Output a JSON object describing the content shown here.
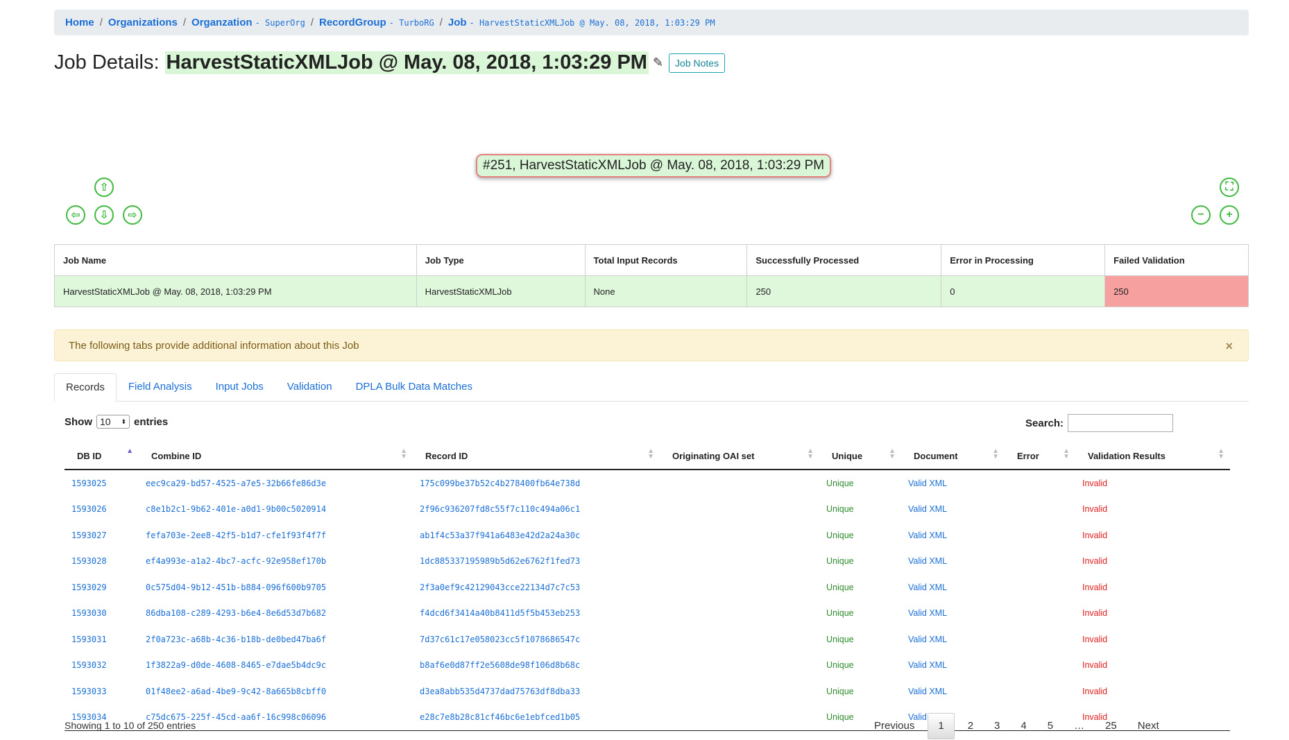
{
  "breadcrumb": {
    "home": "Home",
    "organizations": "Organizations",
    "organization": {
      "label": "Organzation",
      "sub": "- SuperOrg"
    },
    "record_group": {
      "label": "RecordGroup",
      "sub": "- TurboRG"
    },
    "job": {
      "label": "Job",
      "sub": "- HarvestStaticXMLJob @ May. 08, 2018, 1:03:29 PM"
    },
    "separator": "/"
  },
  "title": {
    "prefix": "Job Details:",
    "name": "HarvestStaticXMLJob @ May. 08, 2018, 1:03:29 PM",
    "edit_icon": "pencil-icon",
    "notes_button": "Job Notes"
  },
  "graph": {
    "node_label": "#251, HarvestStaticXMLJob @ May. 08, 2018, 1:03:29 PM",
    "controls": [
      "arrow-up-icon",
      "arrow-left-icon",
      "arrow-down-icon",
      "arrow-right-icon",
      "fit-icon",
      "zoom-out-icon",
      "zoom-in-icon"
    ],
    "accent": "#3fb93f"
  },
  "summary": {
    "headers": [
      "Job Name",
      "Job Type",
      "Total Input Records",
      "Successfully Processed",
      "Error in Processing",
      "Failed Validation"
    ],
    "values": [
      "HarvestStaticXMLJob @ May. 08, 2018, 1:03:29 PM",
      "HarvestStaticXMLJob",
      "None",
      "250",
      "0",
      "250"
    ]
  },
  "alert": {
    "text": "The following tabs provide additional information about this Job",
    "close": "×"
  },
  "tabs": [
    "Records",
    "Field Analysis",
    "Input Jobs",
    "Validation",
    "DPLA Bulk Data Matches"
  ],
  "table_controls": {
    "show": "Show",
    "length": "10",
    "entries": "entries",
    "search_label": "Search:",
    "search_value": ""
  },
  "records": {
    "columns": [
      "DB ID",
      "Combine ID",
      "Record ID",
      "Originating OAI set",
      "Unique",
      "Document",
      "Error",
      "Validation Results"
    ],
    "rows": [
      {
        "db_id": "1593025",
        "combine_id": "eec9ca29-bd57-4525-a7e5-32b66fe86d3e",
        "record_id": "175c099be37b52c4b278400fb64e738d",
        "oai_set": "",
        "unique": "Unique",
        "document": "Valid XML",
        "error": "",
        "validation": "Invalid"
      },
      {
        "db_id": "1593026",
        "combine_id": "c8e1b2c1-9b62-401e-a0d1-9b00c5020914",
        "record_id": "2f96c936207fd8c55f7c110c494a06c1",
        "oai_set": "",
        "unique": "Unique",
        "document": "Valid XML",
        "error": "",
        "validation": "Invalid"
      },
      {
        "db_id": "1593027",
        "combine_id": "fefa703e-2ee8-42f5-b1d7-cfe1f93f4f7f",
        "record_id": "ab1f4c53a37f941a6483e42d2a24a30c",
        "oai_set": "",
        "unique": "Unique",
        "document": "Valid XML",
        "error": "",
        "validation": "Invalid"
      },
      {
        "db_id": "1593028",
        "combine_id": "ef4a993e-a1a2-4bc7-acfc-92e958ef170b",
        "record_id": "1dc885337195989b5d62e6762f1fed73",
        "oai_set": "",
        "unique": "Unique",
        "document": "Valid XML",
        "error": "",
        "validation": "Invalid"
      },
      {
        "db_id": "1593029",
        "combine_id": "0c575d04-9b12-451b-b884-096f600b9705",
        "record_id": "2f3a0ef9c42129043cce22134d7c7c53",
        "oai_set": "",
        "unique": "Unique",
        "document": "Valid XML",
        "error": "",
        "validation": "Invalid"
      },
      {
        "db_id": "1593030",
        "combine_id": "86dba108-c289-4293-b6e4-8e6d53d7b682",
        "record_id": "f4dcd6f3414a40b8411d5f5b453eb253",
        "oai_set": "",
        "unique": "Unique",
        "document": "Valid XML",
        "error": "",
        "validation": "Invalid"
      },
      {
        "db_id": "1593031",
        "combine_id": "2f0a723c-a68b-4c36-b18b-de0bed47ba6f",
        "record_id": "7d37c61c17e058023cc5f1078686547c",
        "oai_set": "",
        "unique": "Unique",
        "document": "Valid XML",
        "error": "",
        "validation": "Invalid"
      },
      {
        "db_id": "1593032",
        "combine_id": "1f3822a9-d0de-4608-8465-e7dae5b4dc9c",
        "record_id": "b8af6e0d87ff2e5608de98f106d8b68c",
        "oai_set": "",
        "unique": "Unique",
        "document": "Valid XML",
        "error": "",
        "validation": "Invalid"
      },
      {
        "db_id": "1593033",
        "combine_id": "01f48ee2-a6ad-4be9-9c42-8a665b8cbff0",
        "record_id": "d3ea8abb535d4737dad75763df8dba33",
        "oai_set": "",
        "unique": "Unique",
        "document": "Valid XML",
        "error": "",
        "validation": "Invalid"
      },
      {
        "db_id": "1593034",
        "combine_id": "c75dc675-225f-45cd-aa6f-16c998c06096",
        "record_id": "e28c7e8b28c81cf46bc6e1ebfced1b05",
        "oai_set": "",
        "unique": "Unique",
        "document": "Valid XML",
        "error": "",
        "validation": "Invalid"
      }
    ]
  },
  "info": "Showing 1 to 10 of 250 entries",
  "pagination": {
    "previous": "Previous",
    "pages": [
      "1",
      "2",
      "3",
      "4",
      "5",
      "…",
      "25"
    ],
    "current": "1",
    "next": "Next"
  },
  "colors": {
    "success": "#dff8dc",
    "failed": "#f7a0a0",
    "link": "#1a6fd6",
    "invalid": "#e02020",
    "unique": "#2e8b2e"
  }
}
